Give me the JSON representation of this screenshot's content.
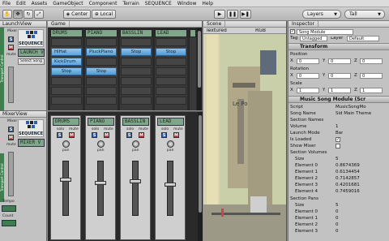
{
  "menubar": {
    "items": [
      "File",
      "Edit",
      "Assets",
      "GameObject",
      "Component",
      "Terrain",
      "SEQUENCE",
      "Window",
      "Help"
    ]
  },
  "toolbar": {
    "center_label": "Center",
    "local_label": "Local",
    "layers_label": "Layers",
    "layout_label": "Tall"
  },
  "launch_view": {
    "title": "LaunchView",
    "side_label": "Transport Control",
    "logo_text": "SEQUENCE",
    "mixer_lcd": "LAUNCH V",
    "select_song": "Select Song",
    "mute_label": "mute"
  },
  "game": {
    "tab_label": "Game",
    "columns": [
      {
        "header": "DRUMS",
        "cells": [
          "",
          "HiHat",
          "KickDrum",
          "Stop"
        ]
      },
      {
        "header": "PIANO",
        "cells": [
          "",
          "PluckPiano",
          "",
          "Stop"
        ]
      },
      {
        "header": "BASSLIN",
        "cells": [
          "",
          "Stop",
          "",
          ""
        ]
      },
      {
        "header": "LEAD",
        "cells": [
          "",
          "Stop",
          "",
          ""
        ]
      }
    ]
  },
  "mixer_view": {
    "title": "MixerView",
    "logo_text": "SEQUENCE",
    "lcd": "MIXER V",
    "side_label": "Transport Control",
    "tempo_label": "Tempo",
    "count_label": "Count"
  },
  "mixer": {
    "strips": [
      {
        "lcd": "DRUMS",
        "solo": "solo",
        "mute": "mute",
        "pan": "pan",
        "s": "S",
        "m": "M"
      },
      {
        "lcd": "PIANO",
        "solo": "solo",
        "mute": "mute",
        "pan": "pan",
        "s": "S",
        "m": "M"
      },
      {
        "lcd": "BASSLIN",
        "solo": "solo",
        "mute": "mute",
        "pan": "pan",
        "s": "S",
        "m": "M"
      },
      {
        "lcd": "LEAD",
        "solo": "solo",
        "mute": "mute",
        "pan": "pan",
        "s": "S",
        "m": "M"
      }
    ]
  },
  "scene": {
    "tab_label": "Scene",
    "mode": "Textured",
    "rgb": "RGB",
    "sign_text": "Le Po"
  },
  "inspector": {
    "tab_label": "Inspector",
    "object_name": "Song Module",
    "tag_label": "Tag",
    "tag_value": "Untagged",
    "layer_label": "Layer",
    "layer_value": "Default",
    "transform_label": "Transform",
    "position_label": "Position",
    "position": {
      "x": "0",
      "y": "0",
      "z": "0"
    },
    "rotation_label": "Rotation",
    "rotation": {
      "x": "0",
      "y": "0",
      "z": "0"
    },
    "scale_label": "Scale",
    "scale": {
      "x": "1",
      "y": "1",
      "z": "1"
    },
    "music_module_label": "Music Song Module (Scr",
    "rows": [
      {
        "label": "Script",
        "value": "MusicSongMo"
      },
      {
        "label": "Song Name",
        "value": "Sid Main Theme"
      },
      {
        "label": "Section Names",
        "value": ""
      },
      {
        "label": "Volume",
        "value": "1"
      },
      {
        "label": "Launch Mode",
        "value": "Bar"
      },
      {
        "label": "Is Loaded",
        "value": ""
      },
      {
        "label": "Show Mixer",
        "value": ""
      },
      {
        "label": "Section Volumes",
        "value": ""
      },
      {
        "label": "Size",
        "value": "5"
      },
      {
        "label": "Element 0",
        "value": "0.8674369"
      },
      {
        "label": "Element 1",
        "value": "0.6134454"
      },
      {
        "label": "Element 2",
        "value": "0.7142857"
      },
      {
        "label": "Element 3",
        "value": "0.4201681"
      },
      {
        "label": "Element 4",
        "value": "0.7459016"
      },
      {
        "label": "Section Pans",
        "value": ""
      },
      {
        "label": "Size",
        "value": "5"
      },
      {
        "label": "Element 0",
        "value": "0"
      },
      {
        "label": "Element 1",
        "value": "0"
      },
      {
        "label": "Element 2",
        "value": "0"
      },
      {
        "label": "Element 3",
        "value": "0"
      }
    ]
  }
}
